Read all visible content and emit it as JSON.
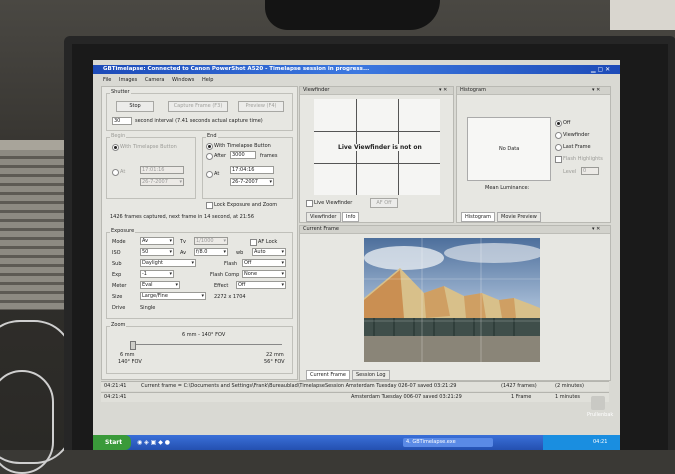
{
  "window": {
    "title": "GBTimelapse: Connected to Canon PowerShot A520 - Timelapse session in progress...",
    "menu": [
      "File",
      "Images",
      "Camera",
      "Windows",
      "Help"
    ]
  },
  "shutter": {
    "group_label": "Shutter",
    "stop_button": "Stop",
    "capture_button": "Capture Frame (F3)",
    "preview_button": "Preview (F4)",
    "interval_value": "30",
    "interval_text": "second interval   (7.41 seconds actual capture time)"
  },
  "begin": {
    "group_label": "Begin",
    "option_label": "With Timelapse Button",
    "at_label": "At",
    "time_value": "17:01:16",
    "date_value": "26-7-2007"
  },
  "end": {
    "group_label": "End",
    "option_with_button": "With Timelapse Button",
    "option_after": "After",
    "frames_value": "3000",
    "frames_label": "frames",
    "option_at": "At",
    "time_value": "17:04:16",
    "date_value": "26-7-2007"
  },
  "lock_exposure_label": "Lock Exposure and Zoom",
  "frames_captured": "1426 frames captured, next frame in 14 second, at 21:56",
  "exposure": {
    "group_label": "Exposure",
    "mode_label": "Mode",
    "mode_value": "Av",
    "tv_label": "Tv",
    "tv_value": "1/1000",
    "af_lock_label": "AF Lock",
    "iso_label": "ISO",
    "iso_value": "50",
    "av_label": "Av",
    "av_value": "f/8.0",
    "wb_label": "wb",
    "wb_value": "Auto",
    "sub_label": "Sub",
    "sub_value": "Daylight",
    "flash_label": "Flash",
    "flash_value": "Off",
    "exp_label": "Exp",
    "exp_value": "-1",
    "flash_comp_label": "Flash Comp",
    "flash_comp_value": "None",
    "meter_label": "Meter",
    "meter_value": "Eval",
    "effect_label": "Effect",
    "effect_value": "Off",
    "size_label": "Size",
    "size_value": "Large/Fine",
    "size_dims": "2272 x 1704",
    "drive_label": "Drive",
    "drive_value": "Single"
  },
  "zoom": {
    "group_label": "Zoom",
    "current_label": "6 mm - 140° FOV",
    "min_mm": "6 mm",
    "min_fov": "140° FOV",
    "max_mm": "22 mm",
    "max_fov": "56° FOV"
  },
  "viewfinder": {
    "title": "Viewfinder",
    "message": "Live Viewfinder is not on",
    "live_label": "Live Viewfinder",
    "af_button": "AF Off",
    "tabs": [
      "Viewfinder",
      "Info"
    ]
  },
  "histogram": {
    "title": "Histogram",
    "no_data": "No Data",
    "mean_label": "Mean Luminance:",
    "options": [
      "Off",
      "Viewfinder",
      "Last Frame"
    ],
    "flash_highlight_label": "Flash Highlights",
    "level_label": "Level",
    "level_value": "0",
    "tabs": [
      "Histogram",
      "Movie Preview"
    ]
  },
  "current_frame": {
    "title": "Current Frame",
    "tabs": [
      "Current Frame",
      "Session Log"
    ]
  },
  "statusbar": {
    "time": "04:21:41",
    "message": "Current frame = C:\\Documents and Settings\\Frank\\Bureaublad\\TimelapseSession Amsterdam Tuesday 026-07 saved 03:21:29",
    "frames": "(1427 frames)",
    "duration": "(2 minutes)",
    "time2": "04:21:41",
    "message2": "Amsterdam Tuesday 006-07 saved 03:21:29",
    "frame_count": "1 Frame",
    "duration2": "1 minutes"
  },
  "taskbar": {
    "start_label": "Start",
    "app_button": "4. GBTimelapse.exe",
    "clock": "04:21",
    "desktop_label": "Prullenbak"
  }
}
